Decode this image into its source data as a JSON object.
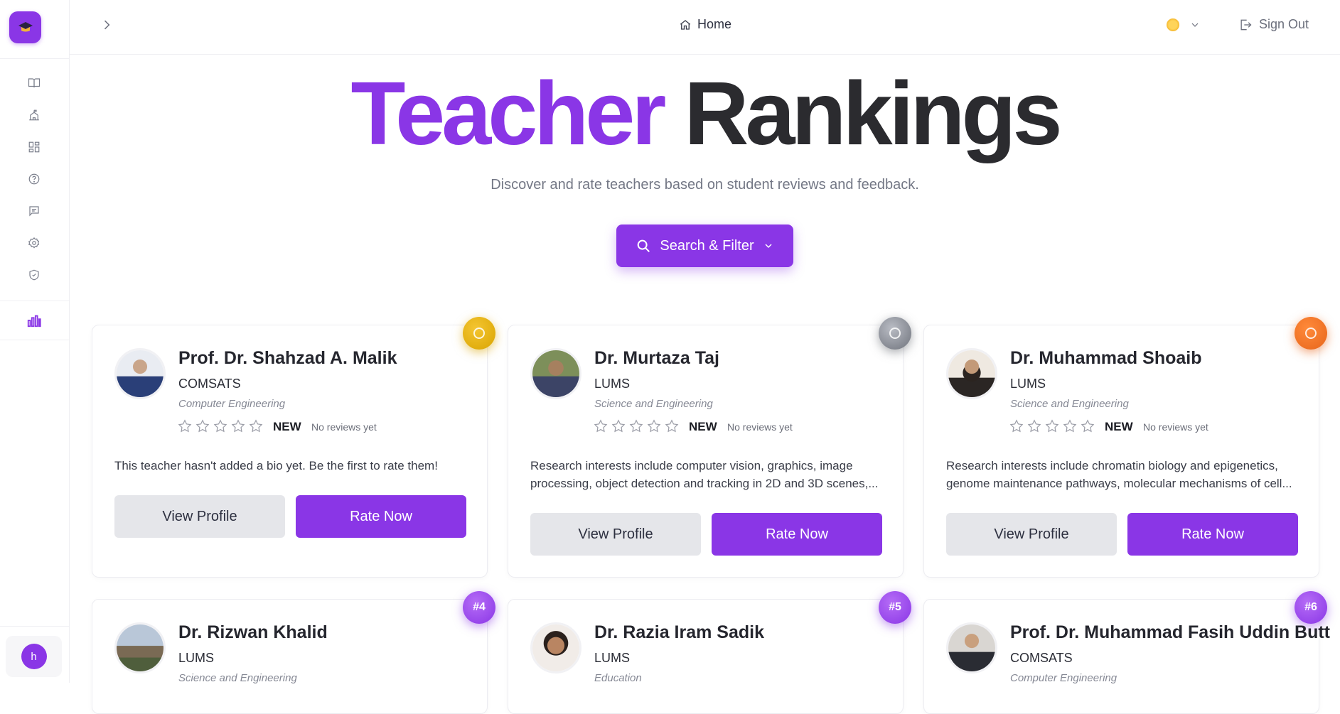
{
  "nav": {
    "home_label": "Home",
    "sign_out_label": "Sign Out",
    "user_initial": "h"
  },
  "sidebar": {
    "items": [
      {
        "icon": "book-icon"
      },
      {
        "icon": "school-icon"
      },
      {
        "icon": "dashboard-icon"
      },
      {
        "icon": "help-icon"
      },
      {
        "icon": "message-icon"
      },
      {
        "icon": "settings-icon"
      },
      {
        "icon": "shield-icon"
      },
      {
        "icon": "bar-chart-icon",
        "active": true
      }
    ]
  },
  "hero": {
    "title_part1": "Teacher",
    "title_part2": "Rankings",
    "subtitle": "Discover and rate teachers based on student reviews and feedback.",
    "filter_label": "Search & Filter"
  },
  "colors": {
    "accent": "#8a36e6",
    "gold": "#e0ad0a",
    "silver": "#8b8e96",
    "bronze": "#f07323"
  },
  "cards": [
    {
      "rank": "1",
      "name": "Prof. Dr. Shahzad A. Malik",
      "university": "COMSATS",
      "department": "Computer Engineering",
      "badge": "NEW",
      "reviews": "No reviews yet",
      "bio": "This teacher hasn't added a bio yet. Be the first to rate them!",
      "view_label": "View Profile",
      "rate_label": "Rate Now"
    },
    {
      "rank": "2",
      "name": "Dr. Murtaza Taj",
      "university": "LUMS",
      "department": "Science and Engineering",
      "badge": "NEW",
      "reviews": "No reviews yet",
      "bio": "Research interests include computer vision, graphics, image processing, object detection and tracking in 2D and 3D scenes,...",
      "view_label": "View Profile",
      "rate_label": "Rate Now"
    },
    {
      "rank": "3",
      "name": "Dr. Muhammad Shoaib",
      "university": "LUMS",
      "department": "Science and Engineering",
      "badge": "NEW",
      "reviews": "No reviews yet",
      "bio": "Research interests include chromatin biology and epigenetics, genome maintenance pathways, molecular mechanisms of cell...",
      "view_label": "View Profile",
      "rate_label": "Rate Now"
    },
    {
      "rank": "#4",
      "name": "Dr. Rizwan Khalid",
      "university": "LUMS",
      "department": "Science and Engineering"
    },
    {
      "rank": "#5",
      "name": "Dr. Razia Iram Sadik",
      "university": "LUMS",
      "department": "Education"
    },
    {
      "rank": "#6",
      "name": "Prof. Dr. Muhammad Fasih Uddin Butt",
      "university": "COMSATS",
      "department": "Computer Engineering"
    }
  ]
}
